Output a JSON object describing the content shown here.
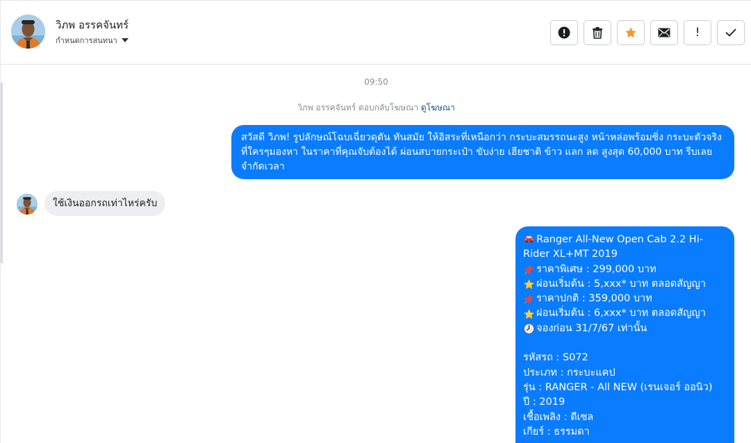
{
  "header": {
    "contact_name": "วิภพ อรรคจันทร์",
    "label_select": "กำหนดการสนทนา",
    "toolbar": [
      {
        "name": "report-button",
        "icon": "alert-circle-icon"
      },
      {
        "name": "delete-button",
        "icon": "trash-icon"
      },
      {
        "name": "star-button",
        "icon": "star-icon"
      },
      {
        "name": "mark-unread-button",
        "icon": "envelope-icon"
      },
      {
        "name": "important-button",
        "icon": "exclamation-icon"
      },
      {
        "name": "done-button",
        "icon": "check-icon"
      }
    ]
  },
  "conversation": {
    "timestamp": "09:50",
    "ad_reply_prefix": "วิภพ อรรคจันทร์ ตอบกลับโฆษณา",
    "ad_reply_link": "ดูโฆษณา",
    "messages": [
      {
        "direction": "outgoing",
        "text": "สวัสดี วิภพ! รูปลักษณ์โฉบเฉี่ยวดุดัน ทันสมัย ให้อิสระที่เหนือกว่า กระบะสมรรถนะสูง หน้าหล่อพร้อมซิ่ง กระบะตัวจริงที่ใครๆมองหา ในราคาที่คุณจับต้องได้ ผ่อนสบายกระเป๋า ขับง่าย เฮียชาติ ข้าว แลก ลด สูงสุด 60,000 บาท รีบเลยจำกัดเวลา"
      },
      {
        "direction": "incoming",
        "text": "ใช้เงินออกรถเท่าไหร่ครับ"
      },
      {
        "direction": "outgoing",
        "lines": [
          {
            "emoji": "car-icon",
            "text": "Ranger All-New Open Cab 2.2 Hi-Rider XL+MT 2019"
          },
          {
            "emoji": "pushpin-icon",
            "text": "ราคาพิเศษ : 299,000 บาท"
          },
          {
            "emoji": "star-icon",
            "text": "ผ่อนเริ่มต้น : 5,xxx* บาท ตลอดสัญญา"
          },
          {
            "emoji": "pushpin-icon",
            "text": "ราคาปกติ : 359,000 บาท"
          },
          {
            "emoji": "star-icon",
            "text": "ผ่อนเริ่มต้น : 6,xxx* บาท ตลอดสัญญา"
          },
          {
            "emoji": "clock-icon",
            "text": "จองก่อน 31/7/67 เท่านั้น"
          },
          {
            "emoji": "",
            "text": ""
          },
          {
            "emoji": "",
            "text": "รหัสรถ : S072"
          },
          {
            "emoji": "",
            "text": "ประเภท : กระบะแคป"
          },
          {
            "emoji": "",
            "text": "รุ่น : RANGER - All NEW (เรนเจอร์ ออนิว)"
          },
          {
            "emoji": "",
            "text": "ปี : 2019"
          },
          {
            "emoji": "",
            "text": "เชื้อเพลิง : ดีเซล"
          },
          {
            "emoji": "",
            "text": "เกียร์ : ธรรมดา"
          }
        ]
      }
    ]
  },
  "colors": {
    "outgoing_bubble": "#0a7cff",
    "incoming_bubble": "#eceef1",
    "star_accent": "#f5962b",
    "link": "#1a4f8b"
  }
}
